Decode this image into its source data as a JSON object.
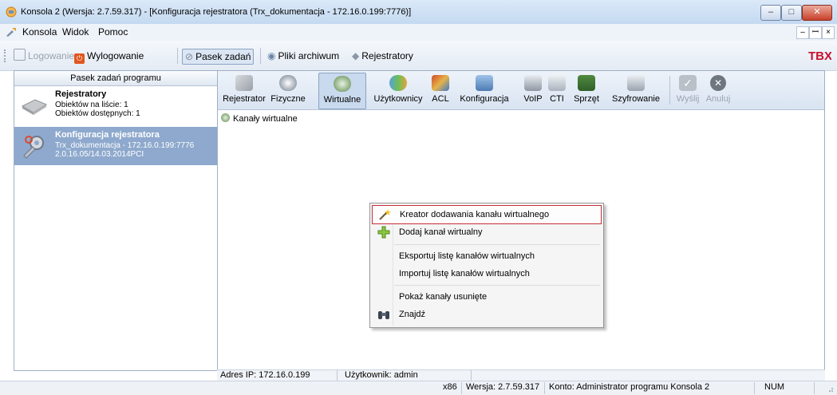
{
  "window": {
    "title": "Konsola 2 (Wersja:  2.7.59.317) - [Konfiguracja rejestratora (Trx_dokumentacja - 172.16.0.199:7776)]",
    "controls": [
      "–",
      "□",
      "✕"
    ]
  },
  "menubar": {
    "items": [
      "Konsola",
      "Widok",
      "Pomoc"
    ],
    "mdi_controls": [
      "–",
      "ꟷ",
      "×"
    ]
  },
  "toolbar": {
    "logowanie": "Logowanie",
    "wylogowanie": "Wylogowanie",
    "pasek_zadan": "Pasek zadań",
    "pliki_archiwum": "Pliki archiwum",
    "rejestratory": "Rejestratory",
    "logo_text": "TBX"
  },
  "left_pane": {
    "header": "Pasek zadań programu",
    "items": [
      {
        "title": "Rejestratory",
        "lines": [
          "Obiektów na liście: 1",
          "Obiektów dostępnych: 1"
        ]
      },
      {
        "title": "Konfiguracja rejestratora",
        "lines": [
          "Trx_dokumentacja - 172.16.0.199:7776",
          "2.0.16.05/14.03.2014PCI"
        ]
      }
    ]
  },
  "right_toolbar": {
    "buttons": [
      "Rejestrator",
      "Fizyczne",
      "Wirtualne",
      "Użytkownicy",
      "ACL",
      "Konfiguracja",
      "VoIP",
      "CTI",
      "Sprzęt",
      "Szyfrowanie",
      "Wyślij",
      "Anuluj"
    ]
  },
  "tree": {
    "root": "Kanały wirtualne"
  },
  "context_menu": {
    "items": [
      "Kreator dodawania kanału wirtualnego",
      "Dodaj kanał wirtualny",
      "Eksportuj listę kanałów wirtualnych",
      "Importuj listę kanałów wirtualnych",
      "Pokaż kanały usunięte",
      "Znajdź"
    ]
  },
  "status_inner": {
    "ip": "Adres IP: 172.16.0.199",
    "user": "Użytkownik: admin"
  },
  "status_outer": {
    "arch": "x86",
    "version": "Wersja: 2.7.59.317",
    "account": "Konto: Administrator programu Konsola 2",
    "num": "NUM"
  },
  "colors": {
    "selection": "#8ea9cd",
    "highlight_border": "#c5303a",
    "accent": "#c8102e"
  }
}
